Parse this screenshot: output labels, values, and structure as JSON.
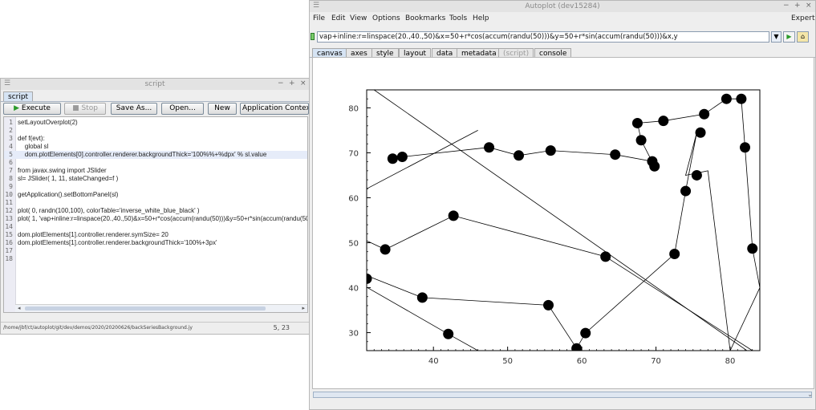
{
  "script_window": {
    "title": "script",
    "tab": "script",
    "buttons": {
      "execute": "Execute",
      "stop": "Stop",
      "save_as": "Save As...",
      "open": "Open...",
      "new": "New",
      "app_context": "Application Context"
    },
    "code_lines": [
      {
        "num": "1",
        "text": "setLayoutOverplot(2)"
      },
      {
        "num": "2",
        "text": ""
      },
      {
        "num": "3",
        "text": "def f(evt):"
      },
      {
        "num": "4",
        "text": "    global sl"
      },
      {
        "num": "5",
        "text": "    dom.plotElements[0].controller.renderer.backgroundThick='100%%+%dpx' % sl.value"
      },
      {
        "num": "6",
        "text": ""
      },
      {
        "num": "7",
        "text": "from javax.swing import JSlider"
      },
      {
        "num": "8",
        "text": "sl= JSlider( 1, 11, stateChanged=f )"
      },
      {
        "num": "9",
        "text": ""
      },
      {
        "num": "10",
        "text": "getApplication().setBottomPanel(sl)"
      },
      {
        "num": "11",
        "text": ""
      },
      {
        "num": "12",
        "text": "plot( 0, randn(100,100), colorTable='inverse_white_blue_black' )"
      },
      {
        "num": "13",
        "text": "plot( 1, 'vap+inline:r=linspace(20.,40.,50)&x=50+r*cos(accum(randu(50)))&y=50+r*sin(accum(randu(50)))&x,y' )"
      },
      {
        "num": "14",
        "text": ""
      },
      {
        "num": "15",
        "text": "dom.plotElements[1].controller.renderer.symSize= 20"
      },
      {
        "num": "16",
        "text": "dom.plotElements[1].controller.renderer.backgroundThick='100%+3px'"
      },
      {
        "num": "17",
        "text": ""
      },
      {
        "num": "18",
        "text": ""
      }
    ],
    "status_path": "/home/jbf/ct/autoplot/git/dev/demos/2020/20200626/backSeriesBackground.jy",
    "caret_pos": "5, 23"
  },
  "autoplot_window": {
    "title": "Autoplot (dev15284)",
    "menu": [
      "File",
      "Edit",
      "View",
      "Options",
      "Bookmarks",
      "Tools",
      "Help"
    ],
    "expert": "Expert",
    "uri_value": "vap+inline:r=linspace(20.,40.,50)&x=50+r*cos(accum(randu(50)))&y=50+r*sin(accum(randu(50)))&x,y",
    "tabs": [
      "canvas",
      "axes",
      "style",
      "layout",
      "data",
      "metadata",
      "(script)",
      "console"
    ]
  },
  "chart_data": {
    "type": "line",
    "x_ticks": [
      40,
      50,
      60,
      70,
      80
    ],
    "y_ticks": [
      30,
      40,
      50,
      60,
      70,
      80
    ],
    "xlim": [
      31,
      84
    ],
    "ylim": [
      26,
      84
    ],
    "marker": "filled-circle",
    "series": [
      {
        "x": [
          34.5,
          35.8,
          47.5,
          51.5,
          55.8,
          64.5,
          69.5,
          69.8,
          68,
          67.5,
          71,
          76.5,
          79.5,
          81.5,
          82,
          83,
          84,
          80,
          77,
          74,
          75.5,
          74,
          72.5,
          60.5,
          59.3
        ],
        "y": [
          68.7,
          69.1,
          71.2,
          69.4,
          70.5,
          69.6,
          68.1,
          67.0,
          72.8,
          76.6,
          77.1,
          78.6,
          82.0,
          82.0,
          71.2,
          48.7,
          40,
          26,
          66,
          65,
          74.5,
          61.5,
          47.5,
          29.9,
          26.5
        ]
      },
      {
        "x": [
          29,
          33.5,
          42.7,
          63.2,
          83
        ],
        "y": [
          52,
          48.5,
          56.0,
          46.9,
          26
        ]
      },
      {
        "x": [
          29,
          38.5,
          55.5,
          59.3
        ],
        "y": [
          44,
          37.8,
          36.1,
          26.5
        ]
      },
      {
        "x": [
          29,
          42,
          46
        ],
        "y": [
          42,
          29.7,
          26
        ]
      },
      {
        "x": [
          31,
          46
        ],
        "y": [
          62,
          75
        ]
      },
      {
        "x": [
          32,
          84
        ],
        "y": [
          84,
          24
        ]
      }
    ],
    "points": {
      "x": [
        34.5,
        35.8,
        47.5,
        51.5,
        55.8,
        64.5,
        69.5,
        69.8,
        68,
        67.5,
        71,
        76.5,
        79.5,
        81.5,
        82,
        83,
        76,
        75.5,
        74,
        72.5,
        60.5,
        59.3,
        55.5,
        38.5,
        42,
        31,
        33.5,
        42.7,
        63.2
      ],
      "y": [
        68.7,
        69.1,
        71.2,
        69.4,
        70.5,
        69.6,
        68.1,
        67.0,
        72.8,
        76.6,
        77.1,
        78.6,
        82.0,
        82.0,
        71.2,
        48.7,
        74.5,
        65.0,
        61.5,
        47.5,
        29.9,
        26.5,
        36.1,
        37.8,
        29.7,
        42.0,
        48.5,
        56.0,
        46.9
      ]
    }
  }
}
